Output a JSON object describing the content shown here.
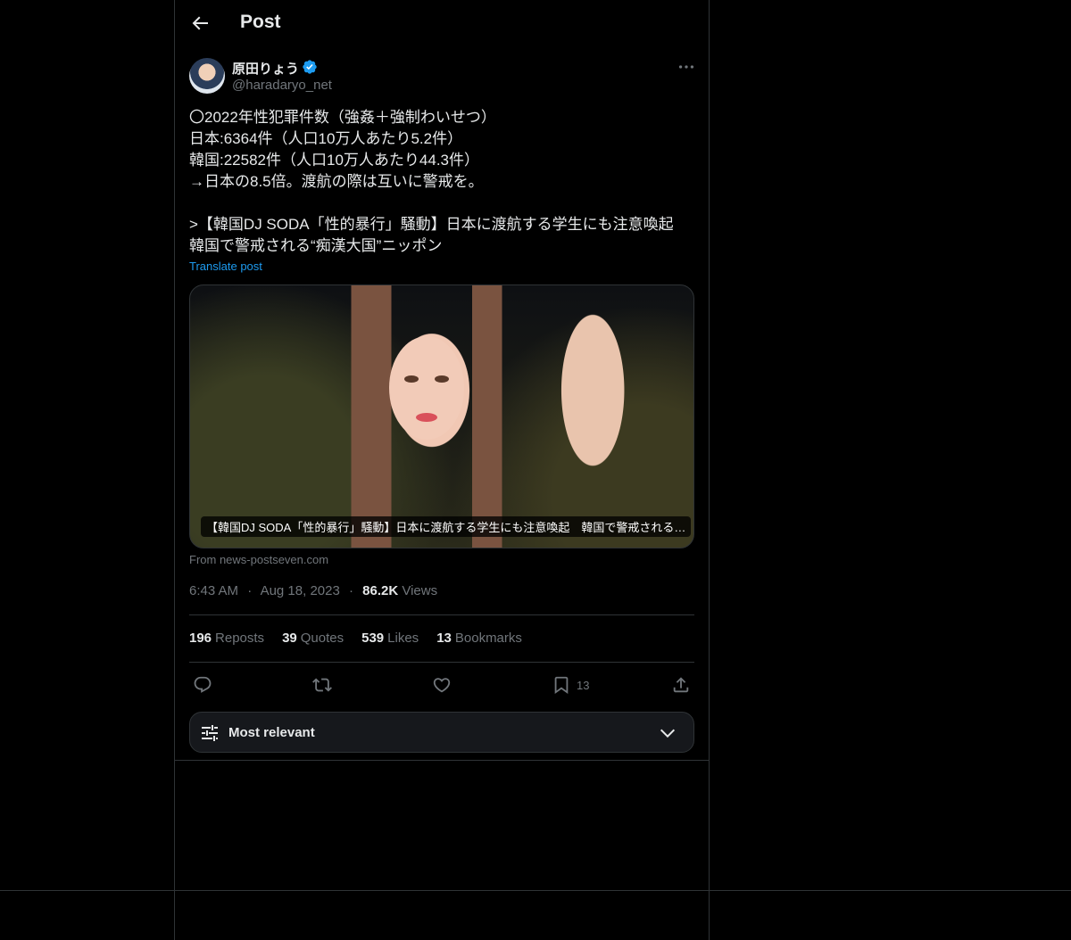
{
  "header": {
    "title": "Post"
  },
  "author": {
    "name": "原田りょう",
    "handle": "@haradaryo_net",
    "verified_color": "#1d9bf0"
  },
  "tweet": {
    "text": "〇2022年性犯罪件数（強姦＋強制わいせつ）\n日本:6364件（人口10万人あたり5.2件）\n韓国:22582件（人口10万人あたり44.3件）\n→日本の8.5倍。渡航の際は互いに警戒を。\n\n>【韓国DJ SODA「性的暴行」騒動】日本に渡航する学生にも注意喚起　韓国で警戒される“痴漢大国”ニッポン",
    "translate_label": "Translate post"
  },
  "media": {
    "caption": "【韓国DJ SODA「性的暴行」騒動】日本に渡航する学生にも注意喚起　韓国で警戒される…",
    "source": "From news-postseven.com"
  },
  "meta": {
    "time": "6:43 AM",
    "sep1": "·",
    "date": "Aug 18, 2023",
    "sep2": "·",
    "views_count": "86.2K",
    "views_label": "Views"
  },
  "stats": [
    {
      "count": "196",
      "label": "Reposts"
    },
    {
      "count": "39",
      "label": "Quotes"
    },
    {
      "count": "539",
      "label": "Likes"
    },
    {
      "count": "13",
      "label": "Bookmarks"
    }
  ],
  "actions": {
    "bookmark_count": "13",
    "icons": [
      "reply-icon",
      "repost-icon",
      "like-icon",
      "bookmark-icon",
      "share-icon"
    ]
  },
  "sort": {
    "label": "Most relevant"
  },
  "colors": {
    "accent": "#1d9bf0",
    "text": "#e7e9ea",
    "muted": "#71767b",
    "border": "#2f3336"
  }
}
